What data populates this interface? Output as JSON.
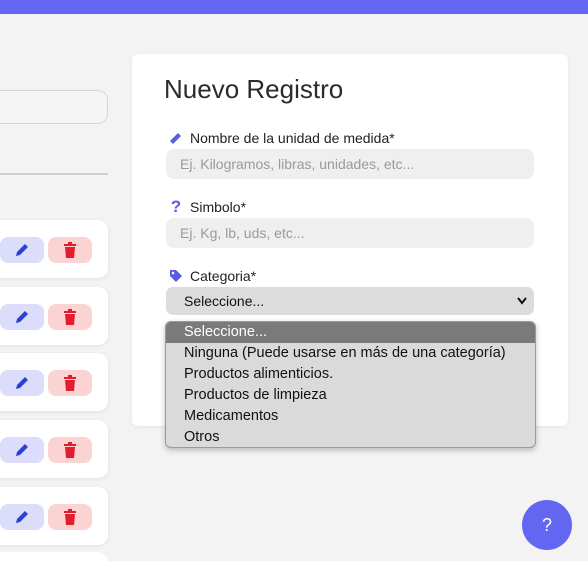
{
  "form": {
    "title": "Nuevo Registro",
    "name_label": "Nombre de la unidad de medida*",
    "name_placeholder": "Ej. Kilogramos, libras, unidades, etc...",
    "symbol_label": "Simbolo*",
    "symbol_icon": "?",
    "symbol_placeholder": "Ej. Kg, lb, uds, etc...",
    "category_label": "Categoria*",
    "category_selected": "Seleccione...",
    "category_options": [
      "Seleccione...",
      "Ninguna (Puede usarse en más de una categoría)",
      "Productos alimenticios.",
      "Productos de limpieza",
      "Medicamentos",
      "Otros"
    ]
  },
  "help_fab_label": "?",
  "colors": {
    "accent": "#6366f1",
    "edit_bg": "#dcdcfb",
    "delete_bg": "#fbd3d3",
    "delete_icon": "#e11d2e",
    "edit_icon": "#2c3fd6"
  }
}
